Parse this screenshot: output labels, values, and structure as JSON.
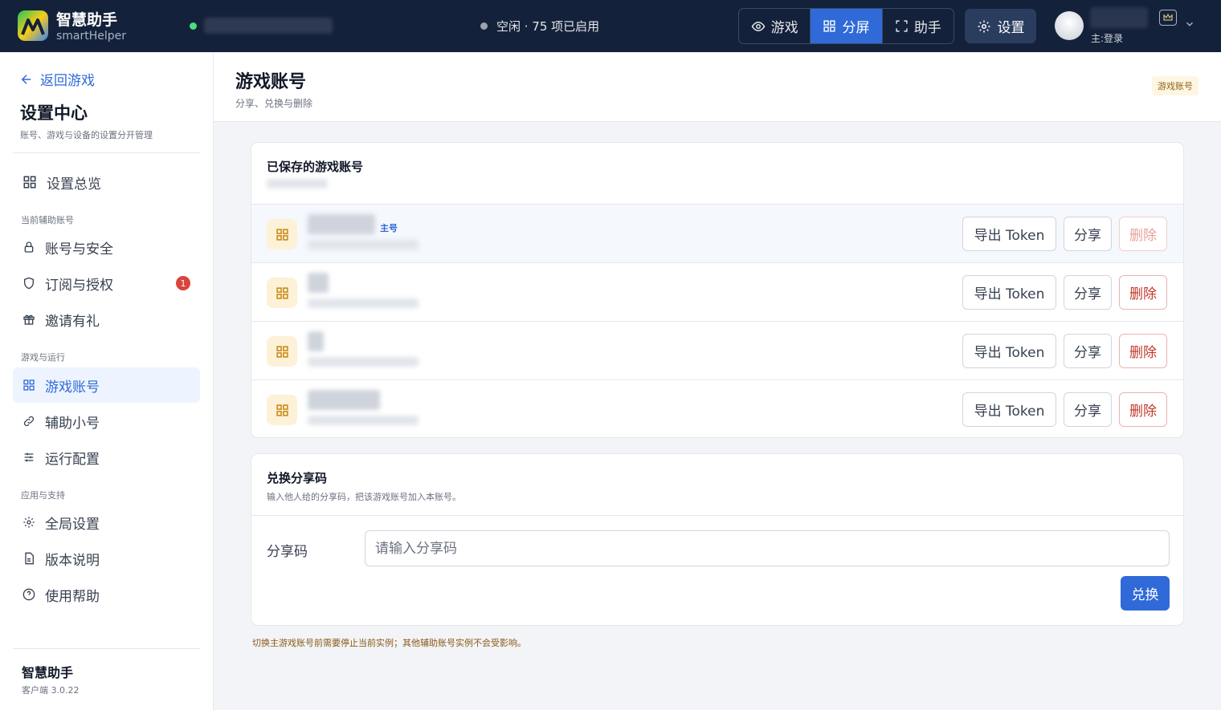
{
  "topbar": {
    "app_name": "智慧助手",
    "app_sub": "smartHelper",
    "status": "空闲 · 75 项已启用",
    "modes": [
      {
        "label": "游戏",
        "icon": "eye-icon",
        "active": false
      },
      {
        "label": "分屏",
        "icon": "grid-icon",
        "active": true
      },
      {
        "label": "助手",
        "icon": "expand-icon",
        "active": false
      }
    ],
    "settings_label": "设置",
    "user_role": "主:登录"
  },
  "sidebar": {
    "back_label": "返回游戏",
    "title": "设置中心",
    "desc": "账号、游戏与设备的设置分开管理",
    "overview": "设置总览",
    "sections": {
      "current": "当前辅助账号",
      "game": "游戏与运行",
      "app": "应用与支持"
    },
    "items": {
      "security": "账号与安全",
      "subscription": "订阅与授权",
      "subscription_badge": "1",
      "invite": "邀请有礼",
      "game_accounts": "游戏账号",
      "alts": "辅助小号",
      "run_config": "运行配置",
      "global": "全局设置",
      "version": "版本说明",
      "help": "使用帮助"
    },
    "footer_title": "智慧助手",
    "footer_version": "客户端 3.0.22"
  },
  "main": {
    "page_title": "游戏账号",
    "page_sub": "分享、兑换与删除",
    "page_badge": "游戏账号",
    "saved_title": "已保存的游戏账号",
    "main_tag": "主号",
    "buttons": {
      "export": "导出 Token",
      "share": "分享",
      "delete": "删除"
    },
    "redeem_title": "兑换分享码",
    "redeem_desc": "输入他人给的分享码，把该游戏账号加入本账号。",
    "share_label": "分享码",
    "share_placeholder": "请输入分享码",
    "redeem_button": "兑换",
    "footnote": "切换主游戏账号前需要停止当前实例；其他辅助账号实例不会受影响。"
  },
  "colors": {
    "accent": "#2f6ad8",
    "topbar": "#14213a",
    "danger": "#c0392b"
  }
}
